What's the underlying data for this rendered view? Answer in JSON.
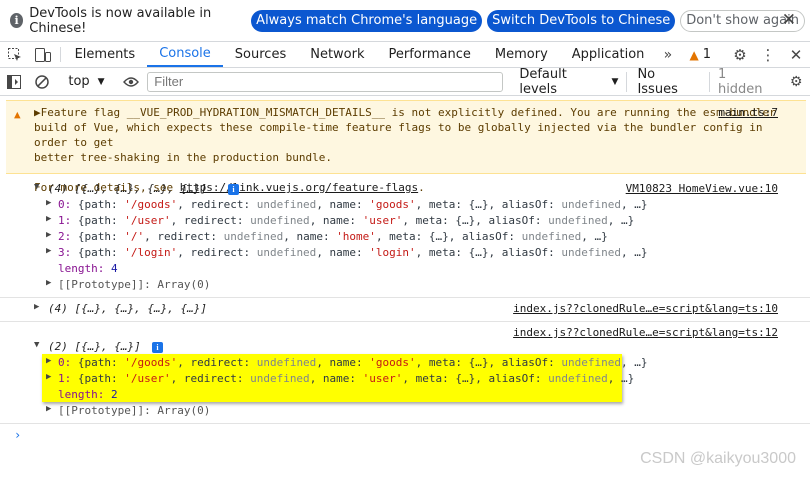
{
  "infobar": {
    "message": "DevTools is now available in Chinese!",
    "btn_match": "Always match Chrome's language",
    "btn_switch": "Switch DevTools to Chinese",
    "btn_dismiss": "Don't show again",
    "close": "✕"
  },
  "tabs": {
    "elements": "Elements",
    "console": "Console",
    "sources": "Sources",
    "network": "Network",
    "performance": "Performance",
    "memory": "Memory",
    "application": "Application",
    "more": "»",
    "warning_count": "1"
  },
  "toolbar": {
    "context": "top",
    "filter_placeholder": "Filter",
    "levels": "Default levels",
    "no_issues": "No Issues",
    "hidden": "1 hidden"
  },
  "warning": {
    "line1": "▶Feature flag __VUE_PROD_HYDRATION_MISMATCH_DETAILS__ is not explicitly defined. You are running the esm-bundler",
    "line2": "build of Vue, which expects these compile-time feature flags to be globally injected via the bundler config in order to get",
    "line3": "better tree-shaking in the production bundle.",
    "line4_prefix": "For more details, see ",
    "link": "https://link.vuejs.org/feature-flags",
    "line4_suffix": ".",
    "source": "main.ts:7"
  },
  "log1": {
    "header": "(4) [{…}, {…}, {…}, {…}]",
    "source": "VM10823 HomeView.vue:10",
    "items": [
      {
        "idx": "0:",
        "path": "'/goods'",
        "name": "'goods'"
      },
      {
        "idx": "1:",
        "path": "'/user'",
        "name": "'user'"
      },
      {
        "idx": "2:",
        "path": "'/'",
        "name": "'home'"
      },
      {
        "idx": "3:",
        "path": "'/login'",
        "name": "'login'"
      }
    ],
    "length_label": "length:",
    "length_value": "4",
    "proto": "[[Prototype]]: Array(0)"
  },
  "log2": {
    "header": "(4) [{…}, {…}, {…}, {…}]",
    "source": "index.js??clonedRule…e=script&lang=ts:10"
  },
  "log3": {
    "header": "(2) [{…}, {…}]",
    "source": "index.js??clonedRule…e=script&lang=ts:12",
    "items": [
      {
        "idx": "0:",
        "path": "'/goods'",
        "name": "'goods'"
      },
      {
        "idx": "1:",
        "path": "'/user'",
        "name": "'user'"
      }
    ],
    "length_label": "length:",
    "length_value": "2",
    "proto": "[[Prototype]]: Array(0)"
  },
  "common": {
    "open": "{path: ",
    "redirect": ", redirect: ",
    "undefined": "undefined",
    "name": ", name: ",
    "meta": ", meta: ",
    "meta_val": "{…}",
    "alias": ", aliasOf: ",
    "close": ", …}"
  },
  "prompt": "›",
  "watermark": "CSDN @kaikyou3000"
}
